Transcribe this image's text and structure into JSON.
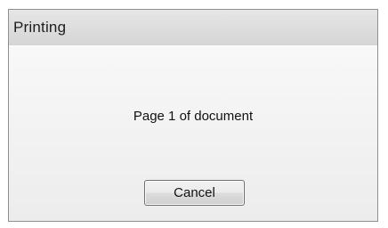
{
  "window": {
    "title": "Printing"
  },
  "dialog": {
    "message": "Page 1 of document",
    "cancel_label": "Cancel"
  },
  "colors": {
    "titlebar": "#d9d9d9",
    "content_background": "#f2f2f2",
    "border": "#8f8f8f",
    "text": "#111111"
  }
}
